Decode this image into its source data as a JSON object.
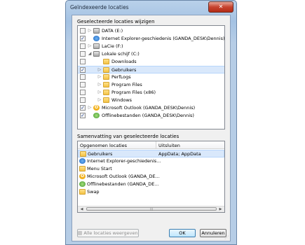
{
  "window": {
    "title": "Geïndexeerde locaties",
    "close_label": "✕"
  },
  "section1": {
    "label": "Geselecteerde locaties wijzigen",
    "items": [
      {
        "label": "DATA (E:)",
        "checked": false,
        "expander": "▷",
        "icon": "drive-icon"
      },
      {
        "label": "Internet Explorer-geschiedenis (GANDA_DESK\\Dennis)",
        "checked": true,
        "expander": "",
        "icon": "ie-icon"
      },
      {
        "label": "LaCie (F:)",
        "checked": false,
        "expander": "▷",
        "icon": "drive-icon"
      },
      {
        "label": "Lokale schijf (C:)",
        "checked": false,
        "expander": "◢",
        "icon": "drive-icon"
      },
      {
        "label": "Downloads",
        "checked": false,
        "expander": "",
        "icon": "folder-icon"
      },
      {
        "label": "Gebruikers",
        "checked": true,
        "expander": "▷",
        "icon": "folder-icon"
      },
      {
        "label": "PerfLogs",
        "checked": false,
        "expander": "▷",
        "icon": "folder-icon"
      },
      {
        "label": "Program Files",
        "checked": false,
        "expander": "▷",
        "icon": "folder-icon"
      },
      {
        "label": "Program Files (x86)",
        "checked": false,
        "expander": "▷",
        "icon": "folder-icon"
      },
      {
        "label": "Windows",
        "checked": false,
        "expander": "▷",
        "icon": "folder-icon"
      },
      {
        "label": "Microsoft Outlook (GANDA_DESK\\Dennis)",
        "checked": true,
        "expander": "▷",
        "icon": "outlook-icon"
      },
      {
        "label": "Offlinebestanden (GANDA_DESK\\Dennis)",
        "checked": true,
        "expander": "",
        "icon": "offline-icon"
      }
    ]
  },
  "section2": {
    "label": "Samenvatting van geselecteerde locaties",
    "col_included": "Opgenomen locaties",
    "col_excluded": "Uitsluiten",
    "rows": [
      {
        "location": "Gebruikers",
        "exclude": "AppData; AppData",
        "icon": "folder-icon"
      },
      {
        "location": "Internet Explorer-geschiedenis...",
        "exclude": "",
        "icon": "ie-icon"
      },
      {
        "location": "Menu Start",
        "exclude": "",
        "icon": "folder-icon"
      },
      {
        "location": "Microsoft Outlook (GANDA_DE...",
        "exclude": "",
        "icon": "outlook-icon"
      },
      {
        "location": "Offlinebestanden (GANDA_DE...",
        "exclude": "",
        "icon": "offline-icon"
      },
      {
        "location": "Swap",
        "exclude": "",
        "icon": "folder-icon"
      }
    ]
  },
  "buttons": {
    "show_all": "Alle locaties weergeven",
    "ok": "OK",
    "cancel": "Annuleren"
  }
}
